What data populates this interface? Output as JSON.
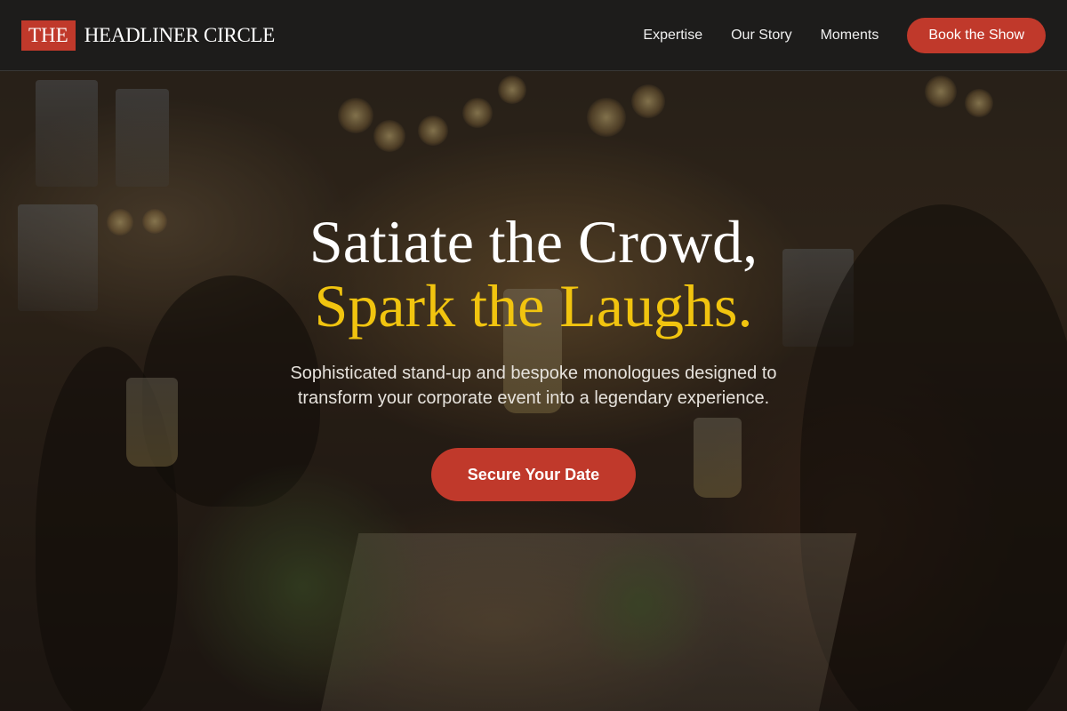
{
  "brand": {
    "mark": "THE",
    "name": "HEADLINER CIRCLE"
  },
  "nav": {
    "links": [
      "Expertise",
      "Our Story",
      "Moments"
    ],
    "cta_label": "Book the Show"
  },
  "hero": {
    "headline_line1": "Satiate the Crowd,",
    "headline_line2": "Spark the Laughs.",
    "subtitle": "Sophisticated stand-up and bespoke monologues designed to transform your corporate event into a legendary experience.",
    "cta_label": "Secure Your Date",
    "background_image": "celebration-toast-photo"
  },
  "colors": {
    "accent": "#c0392b",
    "highlight": "#f1c40f",
    "header_bg": "#1c1c1c"
  }
}
